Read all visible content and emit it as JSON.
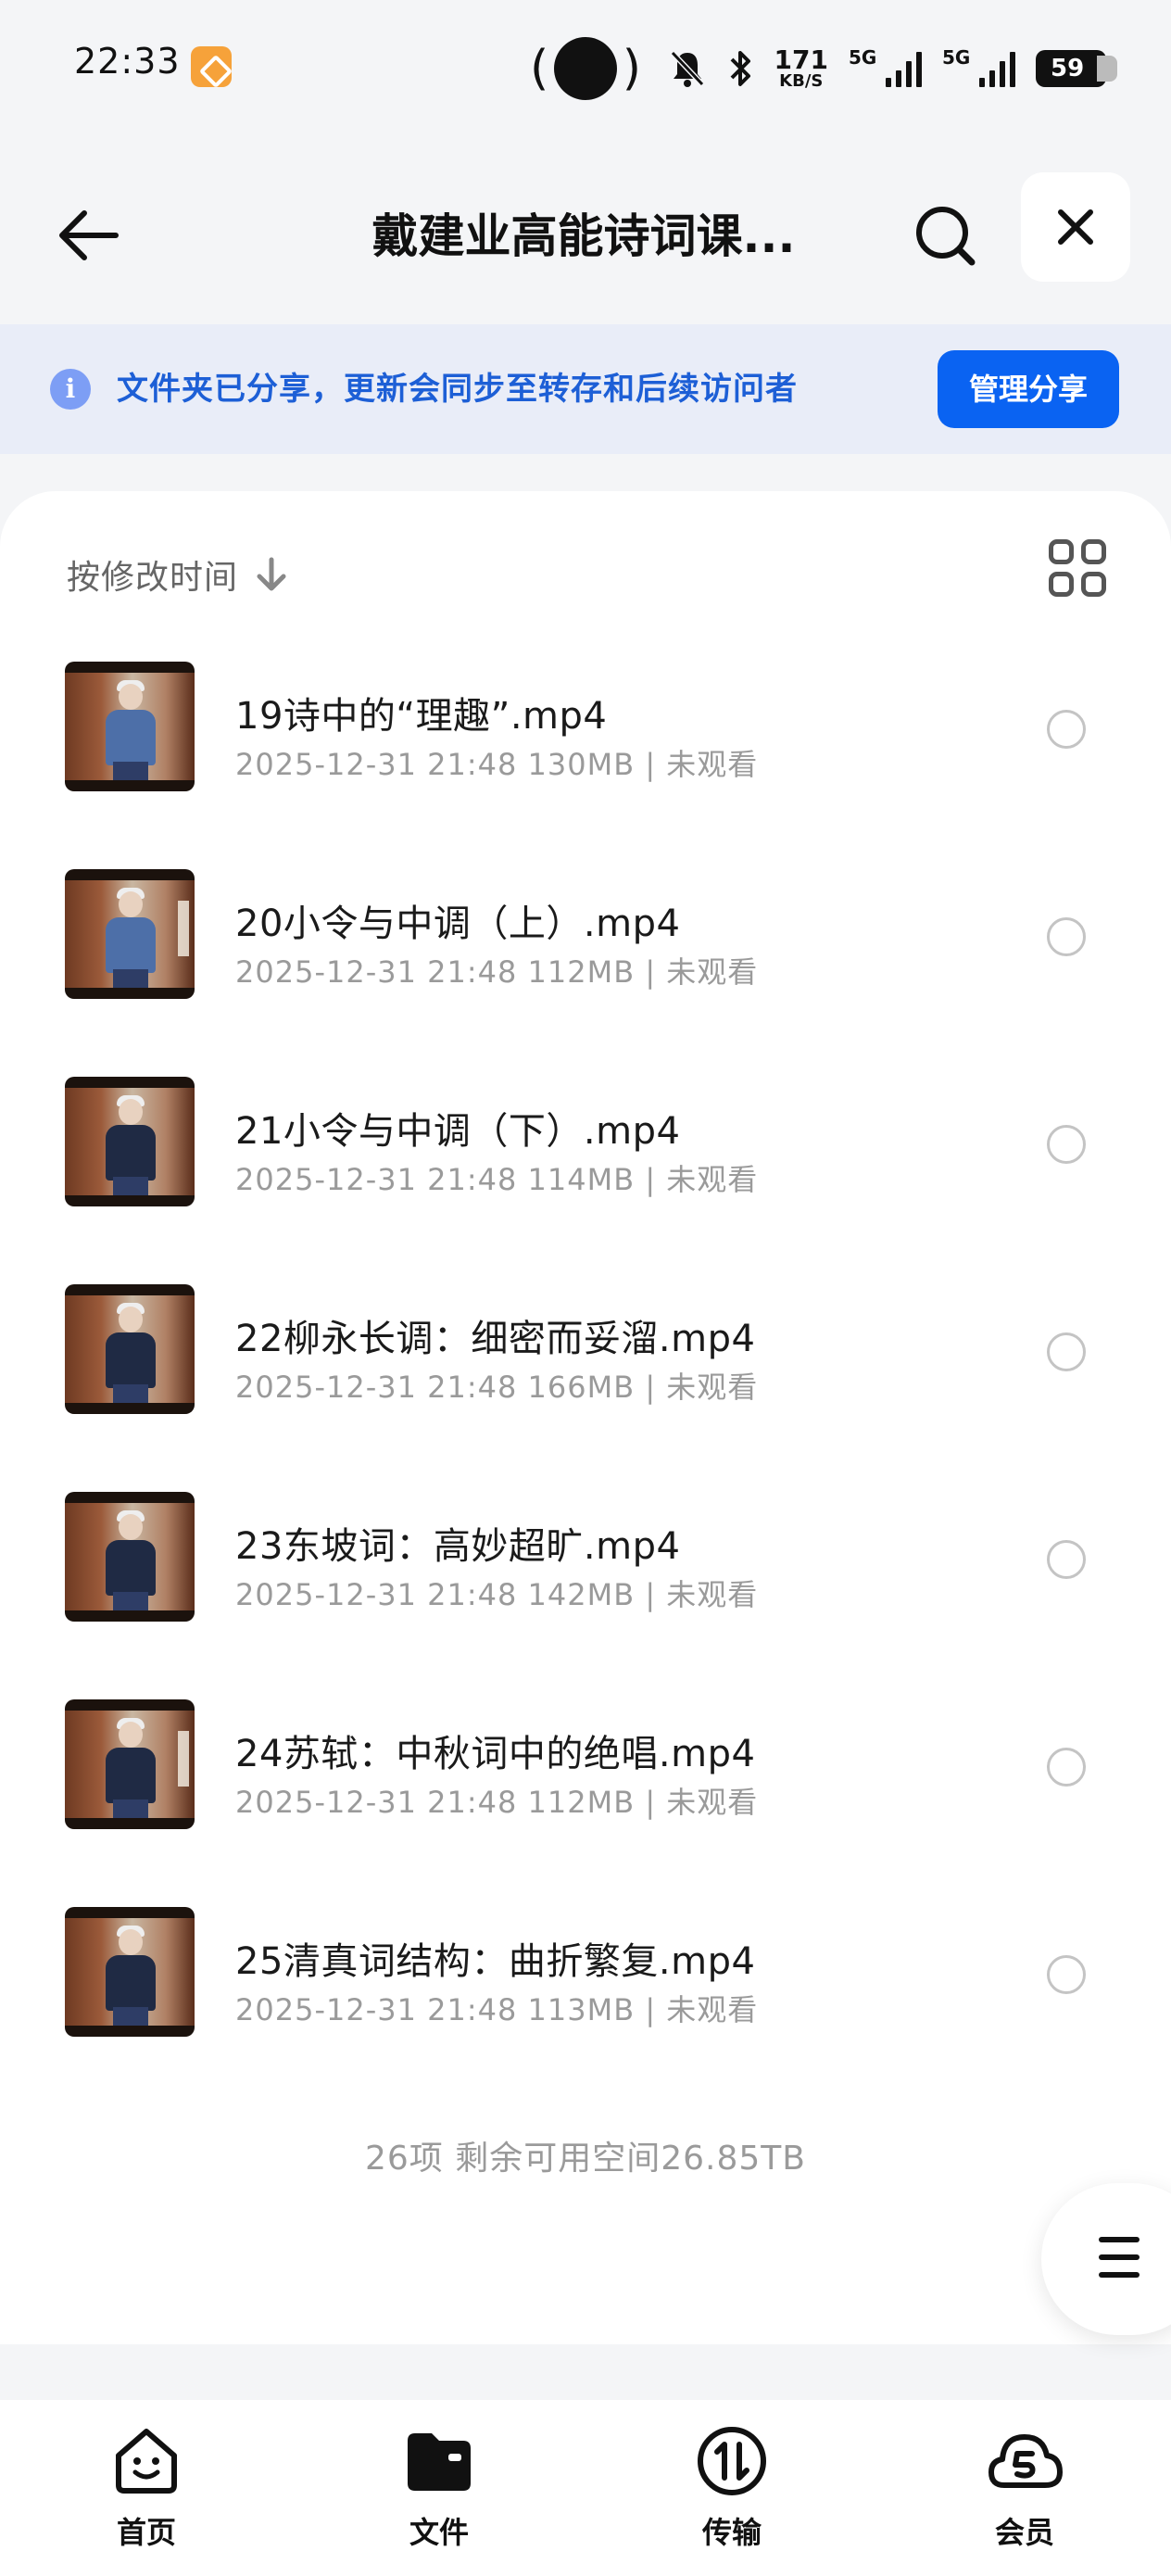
{
  "status_bar": {
    "time": "22:33",
    "net_speed_value": "171",
    "net_speed_unit": "KB/S",
    "sim1_label": "5G",
    "sim2_label": "5G",
    "battery_level": "59"
  },
  "header": {
    "title": "戴建业高能诗词课..."
  },
  "share_banner": {
    "text": "文件夹已分享，更新会同步至转存和后续访问者",
    "button_label": "管理分享"
  },
  "sort": {
    "label": "按修改时间"
  },
  "files": [
    {
      "name": "19诗中的“理趣”.mp4",
      "meta": "2025-12-31 21:48  130MB | 未观看"
    },
    {
      "name": "20小令与中调（上）.mp4",
      "meta": "2025-12-31 21:48  112MB | 未观看"
    },
    {
      "name": "21小令与中调（下）.mp4",
      "meta": "2025-12-31 21:48  114MB | 未观看"
    },
    {
      "name": "22柳永长调：细密而妥溜.mp4",
      "meta": "2025-12-31 21:48  166MB | 未观看"
    },
    {
      "name": "23东坡词：高妙超旷.mp4",
      "meta": "2025-12-31 21:48  142MB | 未观看"
    },
    {
      "name": "24苏轼：中秋词中的绝唱.mp4",
      "meta": "2025-12-31 21:48  112MB | 未观看"
    },
    {
      "name": "25清真词结构：曲折繁复.mp4",
      "meta": "2025-12-31 21:48  113MB | 未观看"
    }
  ],
  "summary": "26项 剩余可用空间26.85TB",
  "bottom_nav": [
    {
      "label": "首页",
      "icon": "home-face-icon"
    },
    {
      "label": "文件",
      "icon": "folder-icon"
    },
    {
      "label": "传输",
      "icon": "transfer-icon"
    },
    {
      "label": "会员",
      "icon": "vip-cloud-icon"
    }
  ],
  "colors": {
    "accent": "#0a63f2",
    "banner_bg": "#e9edf8",
    "banner_text": "#1d5fd6"
  }
}
